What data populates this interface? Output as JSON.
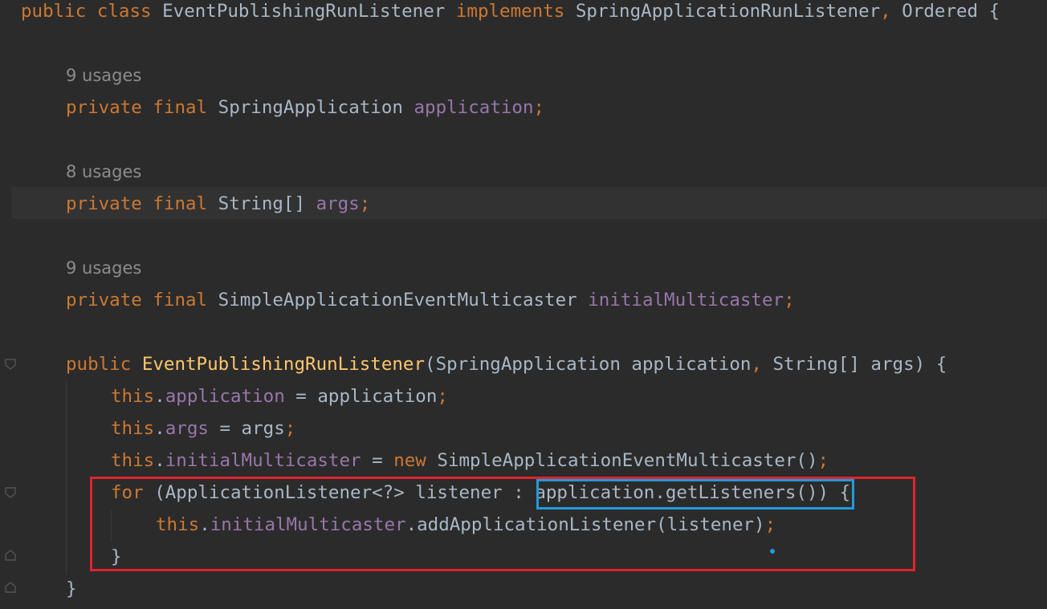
{
  "code": {
    "line1": {
      "kw1": "public class ",
      "name": "EventPublishingRunListener ",
      "kw2": "implements ",
      "rest": "SpringApplicationRunListener",
      "comma": ", ",
      "ordered": "Ordered {"
    },
    "hint1": "9 usages",
    "line2": {
      "kw": "private final ",
      "type": "SpringApplication ",
      "field": "application",
      "semi": ";"
    },
    "hint2": "8 usages",
    "line3": {
      "kw": "private final ",
      "type": "String[] ",
      "field": "args",
      "semi": ";"
    },
    "hint3": "9 usages",
    "line4": {
      "kw": "private final ",
      "type": "SimpleApplicationEventMulticaster ",
      "field": "initialMulticaster",
      "semi": ";"
    },
    "line5": {
      "kw": "public ",
      "fn": "EventPublishingRunListener",
      "p1": "(SpringApplication application",
      "c1": ", ",
      "p2": "String[] args) {"
    },
    "line6": {
      "this": "this",
      "dot": ".",
      "field": "application",
      "rest": " = application",
      "semi": ";"
    },
    "line7": {
      "this": "this",
      "dot": ".",
      "field": "args",
      "rest": " = args",
      "semi": ";"
    },
    "line8": {
      "this": "this",
      "dot": ".",
      "field": "initialMulticaster",
      "eq": " = ",
      "new": "new ",
      "rest": "SimpleApplicationEventMulticaster()",
      "semi": ";"
    },
    "line9": {
      "for": "for ",
      "rest1": "(ApplicationListener<?> listener : ",
      "call": "application.getListeners()",
      "rest2": ") {"
    },
    "line10": {
      "this": "this",
      "dot": ".",
      "field": "initialMulticaster",
      "rest": ".addApplicationListener(listener)",
      "semi": ";"
    },
    "line11": "}",
    "line12": "}"
  },
  "colors": {
    "background": "#2b2b2b",
    "keyword": "#cc7832",
    "field": "#9876aa",
    "method_decl": "#ffc66d",
    "plain": "#a9b7c6",
    "inlay_hint": "#8c8c8c",
    "highlight_red": "#e0232e",
    "highlight_blue": "#1f9bdc"
  }
}
